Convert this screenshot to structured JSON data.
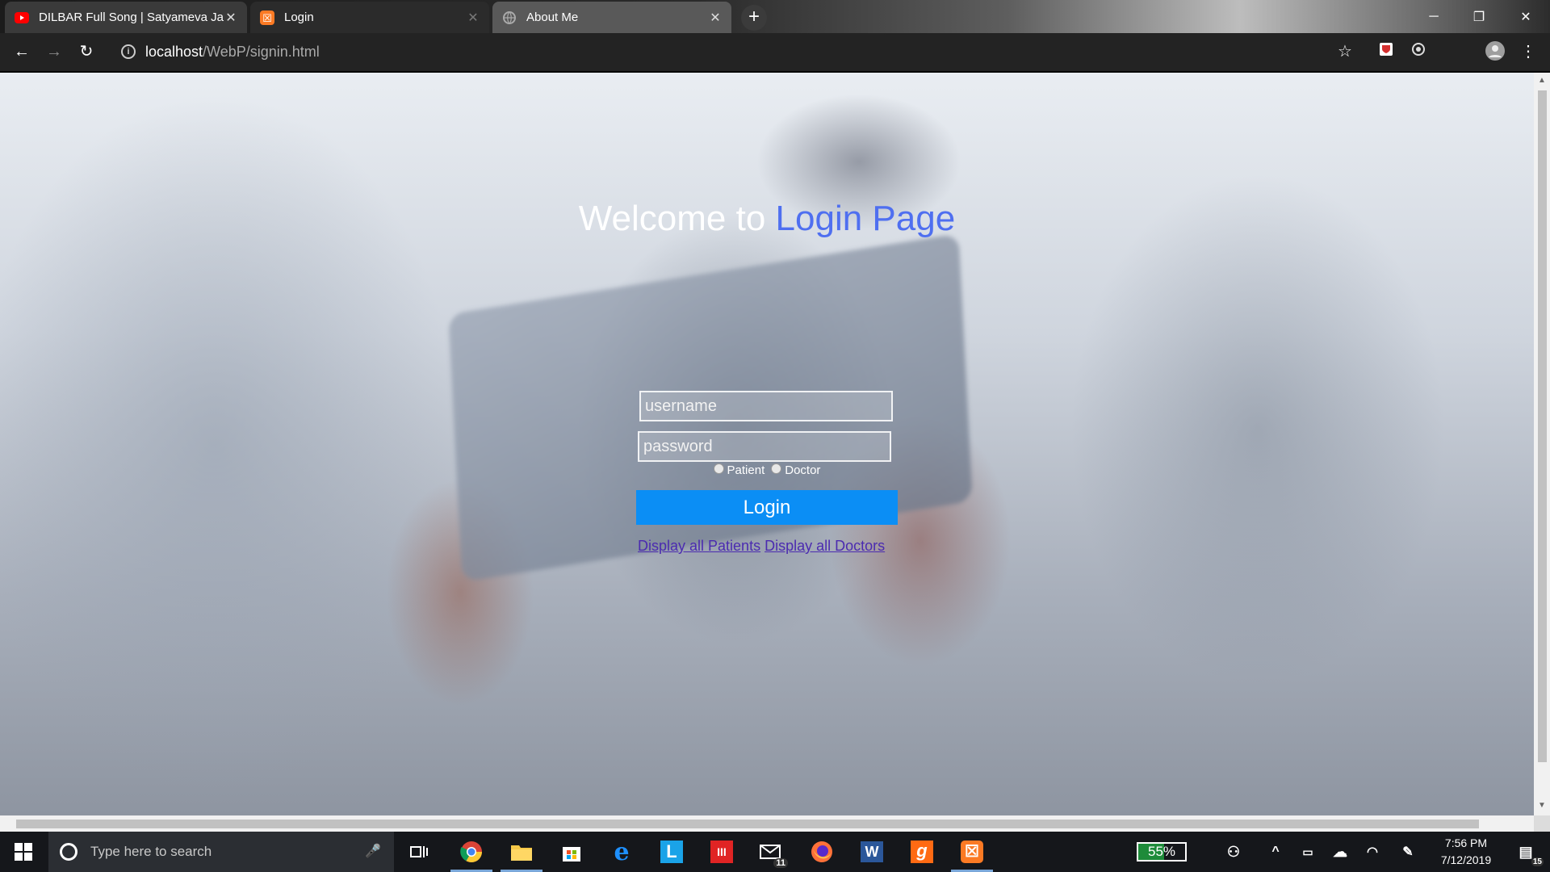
{
  "browser": {
    "tabs": [
      {
        "title": "DILBAR Full Song | Satyameva Ja",
        "favicon": "youtube-icon"
      },
      {
        "title": "Login",
        "favicon": "xampp-icon"
      },
      {
        "title": "About Me",
        "favicon": "globe-icon"
      }
    ],
    "url_host": "localhost",
    "url_path": "/WebP/signin.html"
  },
  "page": {
    "welcome_prefix": "Welcome to",
    "welcome_accent": "Login Page",
    "username_placeholder": "username",
    "password_placeholder": "password",
    "radio_patient": "Patient",
    "radio_doctor": "Doctor",
    "login_button": "Login",
    "link_patients": "Display all Patients",
    "link_doctors": "Display all Doctors",
    "colors": {
      "accent": "#4f6ff0",
      "button": "#0b8ef5",
      "link": "#4b2bb0"
    }
  },
  "taskbar": {
    "search_placeholder": "Type here to search",
    "battery_percent": 55,
    "battery_label": "55%",
    "mail_badge": "11",
    "notification_badge": "15",
    "time": "7:56 PM",
    "date": "7/12/2019",
    "apps": [
      "chrome-icon",
      "file-explorer-icon",
      "store-icon",
      "edge-icon",
      "l-app-icon",
      "red-app-icon",
      "mail-icon",
      "firefox-icon",
      "word-icon",
      "g-app-icon",
      "xampp-icon"
    ]
  }
}
